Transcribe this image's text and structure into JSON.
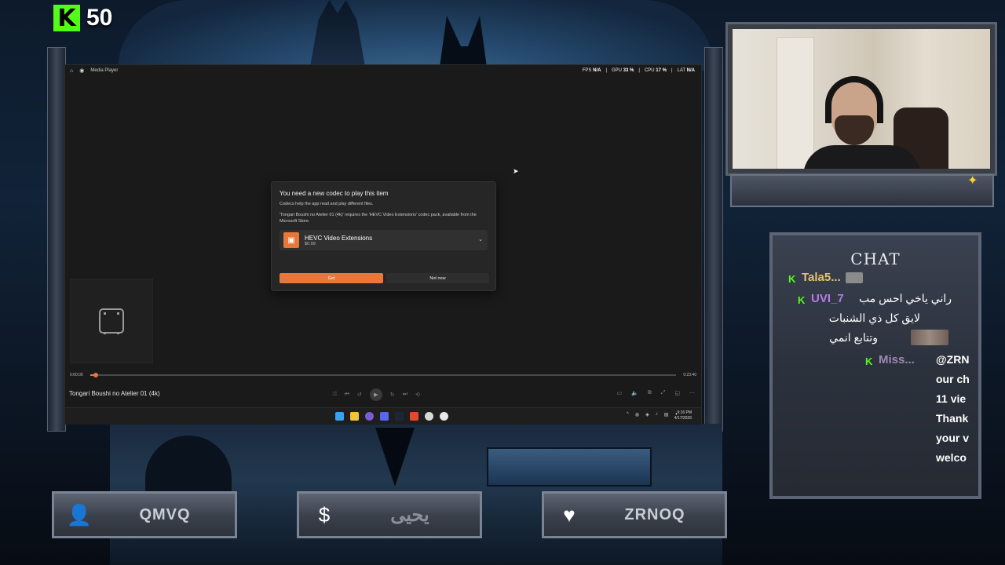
{
  "kick": {
    "logo": "K",
    "count": "50"
  },
  "player": {
    "title": "Media Player",
    "perf": [
      {
        "label": "FPS",
        "value": "N/A"
      },
      {
        "label": "GPU",
        "value": "33 %"
      },
      {
        "label": "CPU",
        "value": "17 %"
      },
      {
        "label": "LAT",
        "value": "N/A"
      }
    ],
    "dialog": {
      "title": "You need a new codec to play this item",
      "line1": "Codecs help the app read and play different files.",
      "line2": "'Tongari Boushi no Atelier 01 (4k)' requires the 'HEVC Video Extensions' codec pack, available from the Microsoft Store.",
      "codec_name": "HEVC Video Extensions",
      "codec_price": "$0.99",
      "get_label": "Get",
      "not_now_label": "Not now"
    },
    "time_current": "0:00:00",
    "time_total": "0:23:40",
    "progress": 0.01,
    "video_title": "Tongari Boushi no Atelier 01 (4k)",
    "clock_time": "9:16 PM",
    "clock_date": "4/17/2026"
  },
  "chat": {
    "title": "CHAT",
    "messages": [
      {
        "user": "Tala5...",
        "color": "#e8c46a",
        "text": ""
      },
      {
        "user": "UVI_7",
        "color": "#b77be8",
        "text": "راني ياخي احس مب"
      },
      {
        "user": "",
        "color": "",
        "text": "لايق كل ذي الشنبات"
      },
      {
        "user": "",
        "color": "",
        "text": "وتتابع انمي"
      },
      {
        "user": "Miss...",
        "color": "#9b8ab0",
        "text": "@ZRN"
      }
    ],
    "overflow_lines": [
      "our ch",
      "11 vie",
      "Thank",
      "your v",
      "welco"
    ]
  },
  "plates": [
    {
      "icon": "user-icon",
      "text": "QMVQ"
    },
    {
      "icon": "dollar-icon",
      "text": "يحيى"
    },
    {
      "icon": "heart-icon",
      "text": "ZRNOQ"
    }
  ]
}
